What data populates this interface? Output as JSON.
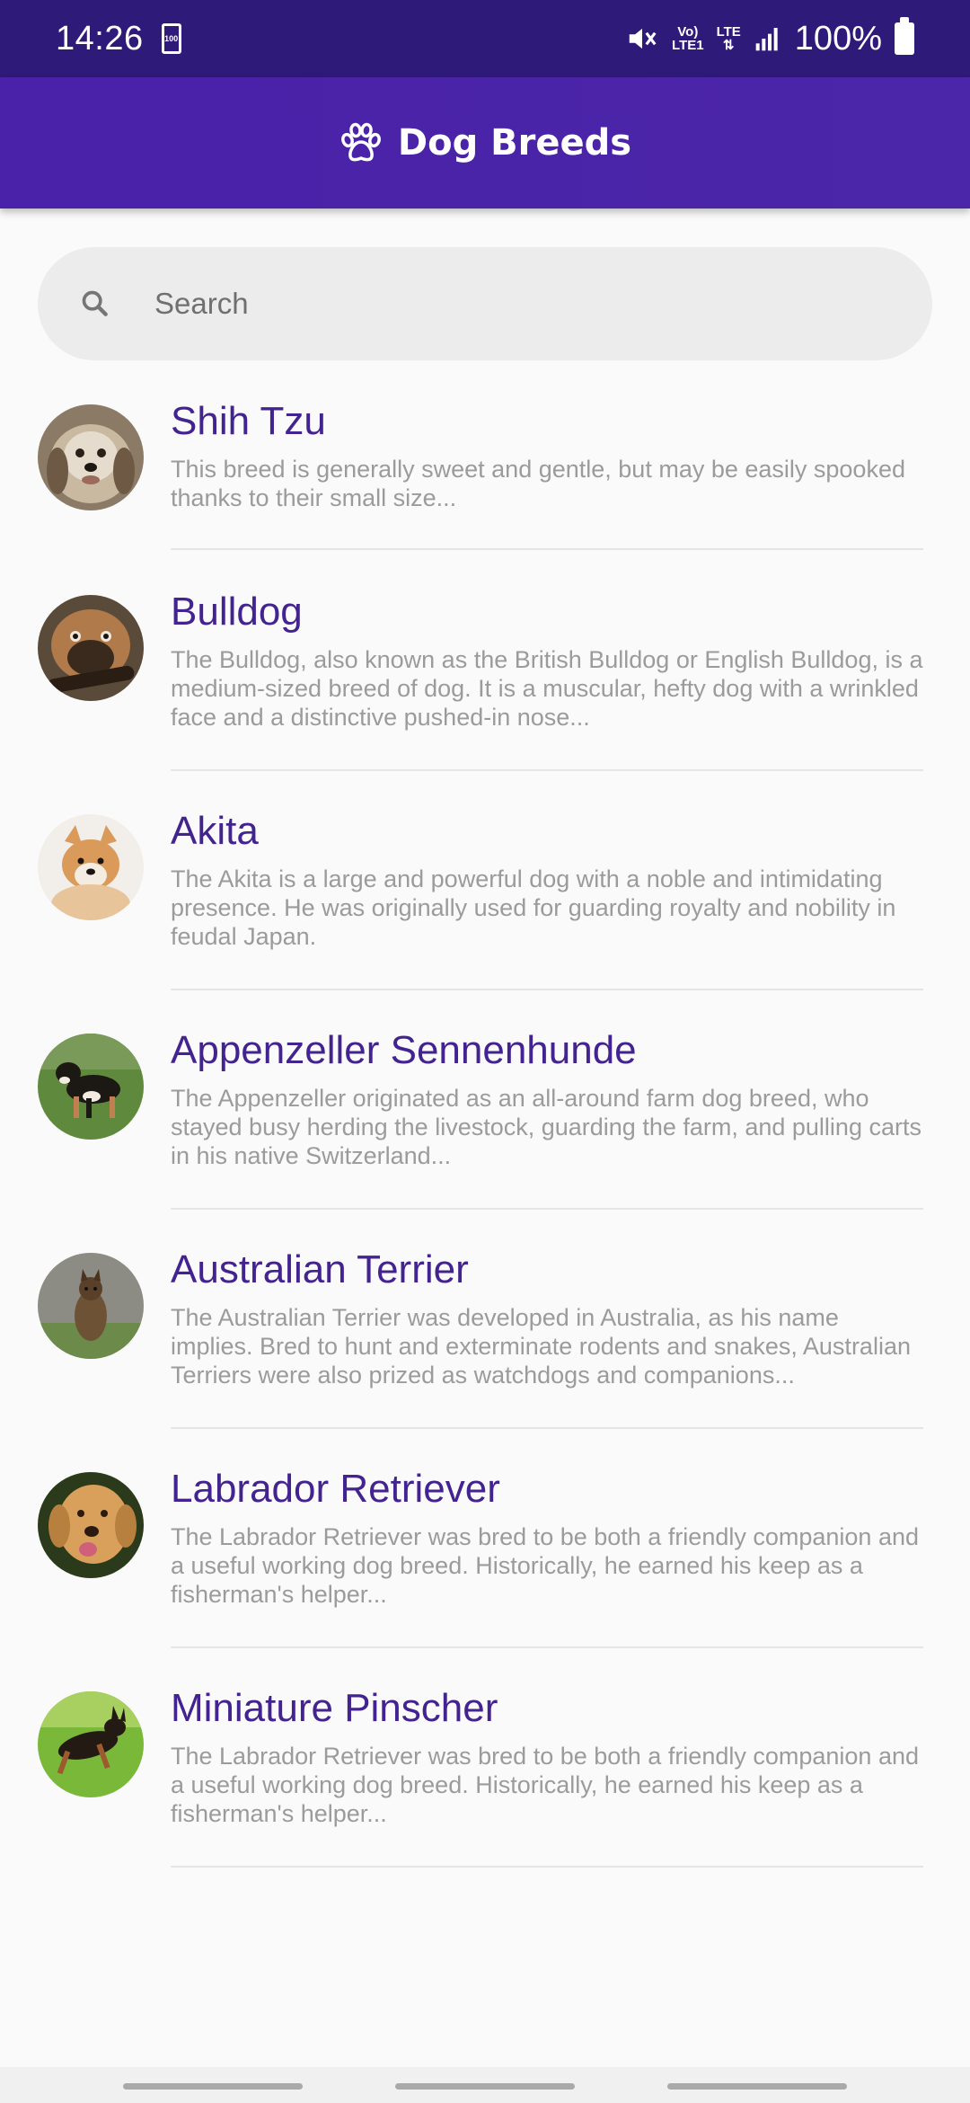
{
  "status_bar": {
    "time": "14:26",
    "small_battery_label": "100",
    "network_top": "Vo)",
    "network_bottom": "LTE1",
    "lte_label": "LTE",
    "battery_percent": "100%"
  },
  "app_bar": {
    "title": "Dog Breeds",
    "icon": "paw-icon",
    "color": "#4a21a9"
  },
  "search": {
    "placeholder": "Search",
    "icon": "search-icon"
  },
  "breeds": [
    {
      "name": "Shih Tzu",
      "description": "This breed is generally sweet and gentle, but may be easily spooked thanks to their small size..."
    },
    {
      "name": "Bulldog",
      "description": "The Bulldog, also known as the British Bulldog or English Bulldog, is a medium-sized breed of dog. It is a muscular, hefty dog with a wrinkled face and a distinctive pushed-in nose..."
    },
    {
      "name": "Akita",
      "description": "The Akita is a large and powerful dog with a noble and intimidating presence. He was originally used for guarding royalty and nobility in feudal Japan."
    },
    {
      "name": "Appenzeller Sennenhunde",
      "description": "The Appenzeller originated as an all-around farm dog breed, who stayed busy herding the livestock, guarding the farm, and pulling carts in his native Switzerland..."
    },
    {
      "name": "Australian Terrier",
      "description": "The Australian Terrier was developed in Australia, as his name implies. Bred to hunt and exterminate rodents and snakes, Australian Terriers were also prized as watchdogs and companions..."
    },
    {
      "name": "Labrador Retriever",
      "description": "The Labrador Retriever was bred to be both a friendly companion and a useful working dog breed. Historically, he earned his keep as a fisherman's helper..."
    },
    {
      "name": "Miniature Pinscher",
      "description": "The Labrador Retriever was bred to be both a friendly companion and a useful working dog breed. Historically, he earned his keep as a fisherman's helper..."
    }
  ],
  "colors": {
    "accent": "#4a21a9",
    "status_bar": "#2e1a78",
    "breed_name": "#43238f",
    "description": "#9b9b9b"
  }
}
